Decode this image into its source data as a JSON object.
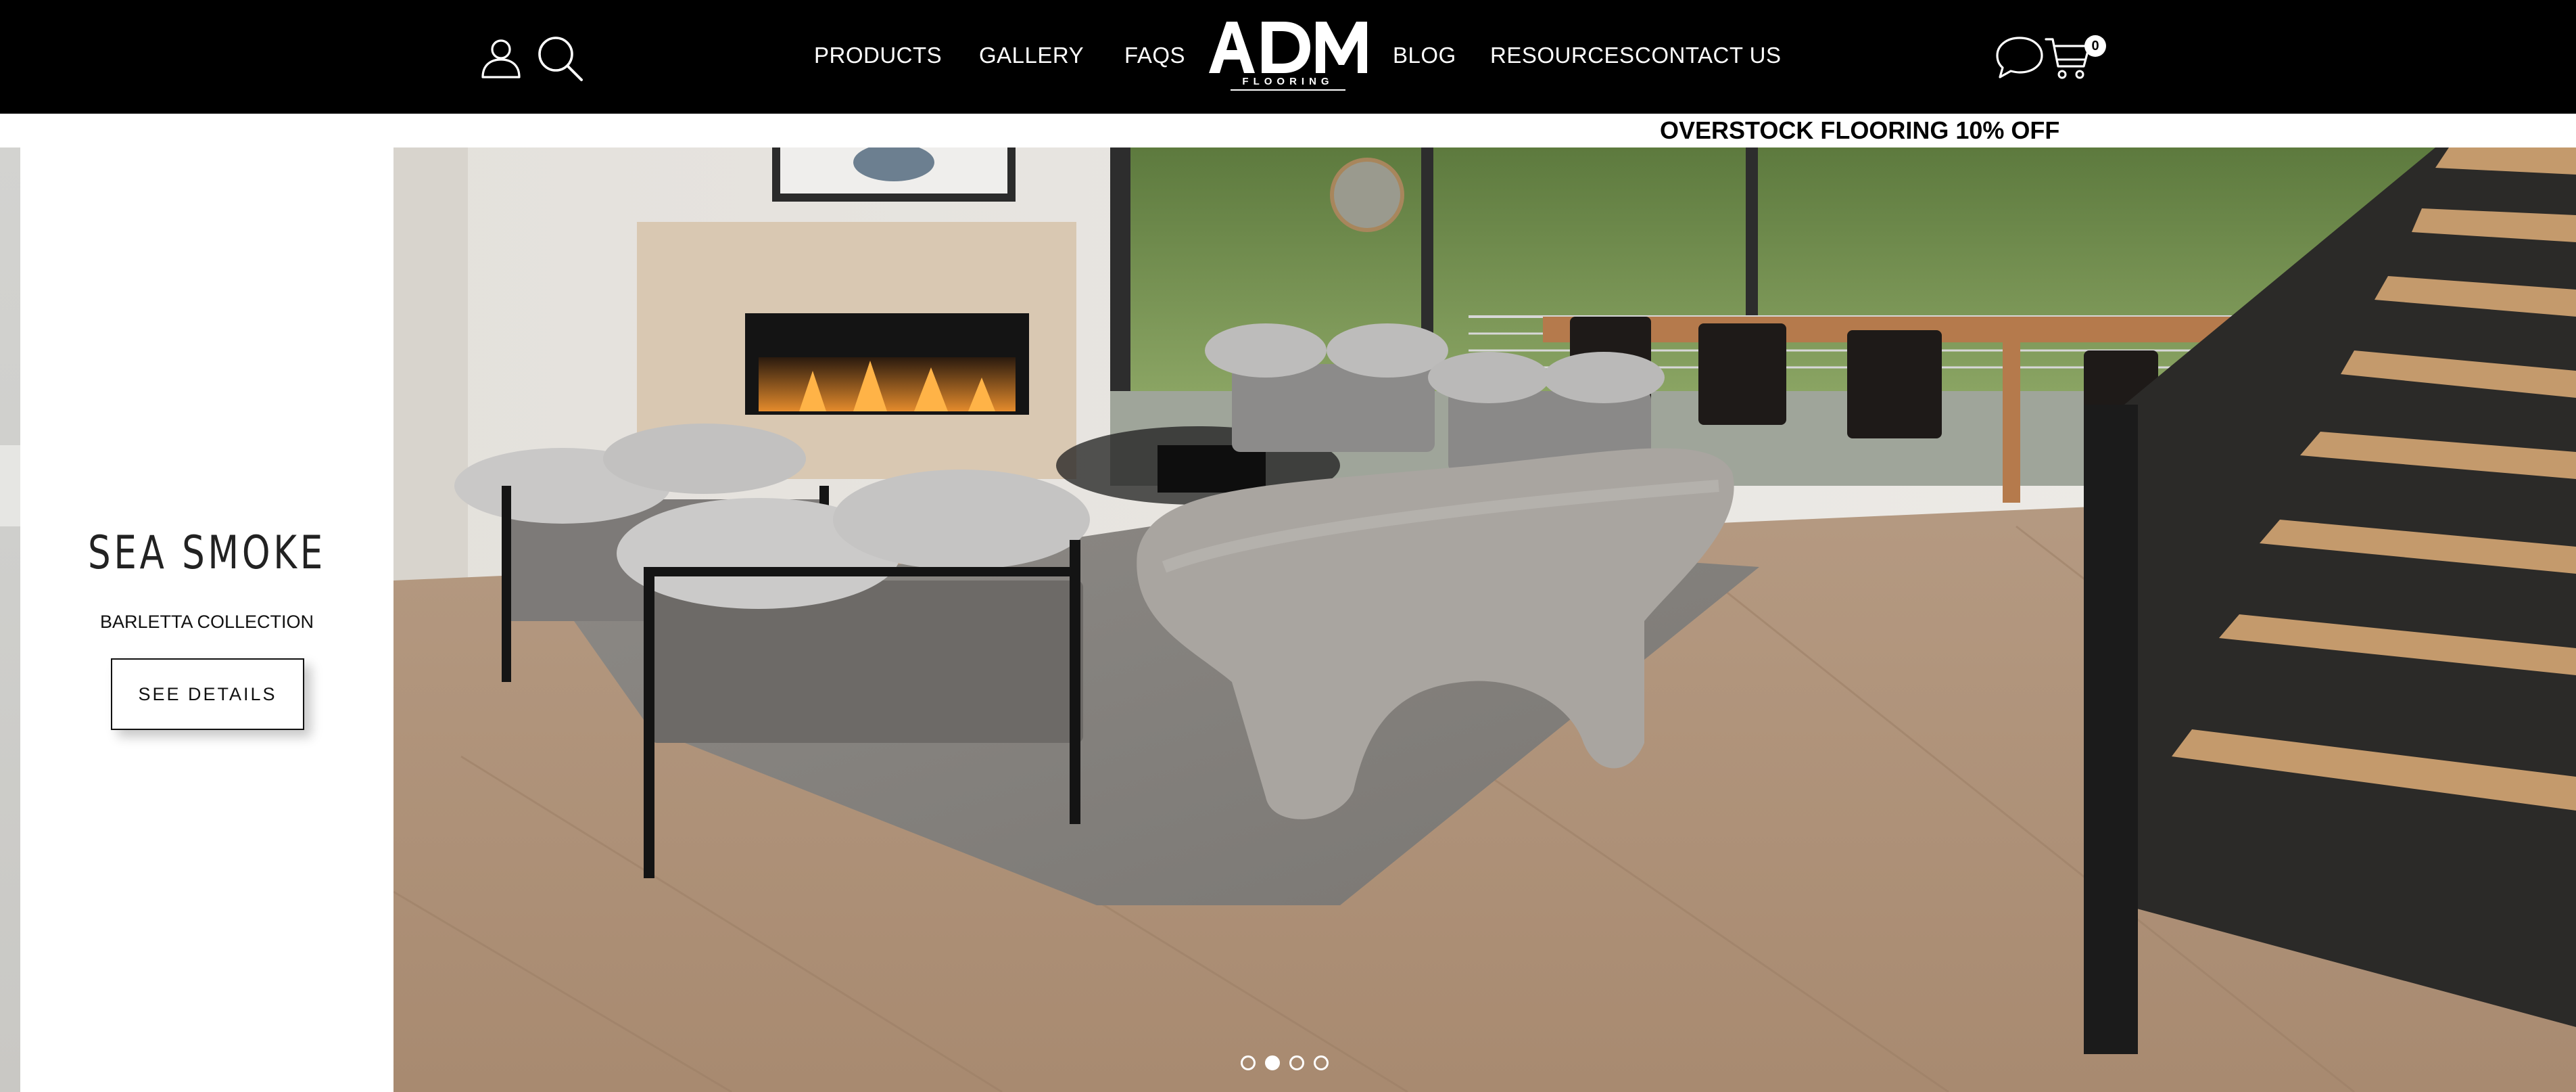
{
  "header": {
    "nav": {
      "products": "PRODUCTS",
      "gallery": "GALLERY",
      "faqs": "FAQS",
      "blog": "BLOG",
      "resources": "RESOURCES",
      "contact": "CONTACT US"
    },
    "logo": {
      "text": "ADM",
      "subtext": "FLOORING"
    },
    "icons": {
      "account": "user-icon",
      "search": "search-icon",
      "chat": "chat-icon",
      "cart": "cart-icon"
    },
    "cart_count": "0"
  },
  "announcement": {
    "text": "OVERSTOCK FLOORING 10% OFF"
  },
  "slider": {
    "title": "SEA SMOKE",
    "collection": "BARLETTA COLLECTION",
    "cta": "SEE DETAILS",
    "total_slides": 4,
    "active_slide": 2
  },
  "colors": {
    "header_bg": "#000000",
    "header_text": "#ffffff",
    "accent_text": "#111111"
  }
}
